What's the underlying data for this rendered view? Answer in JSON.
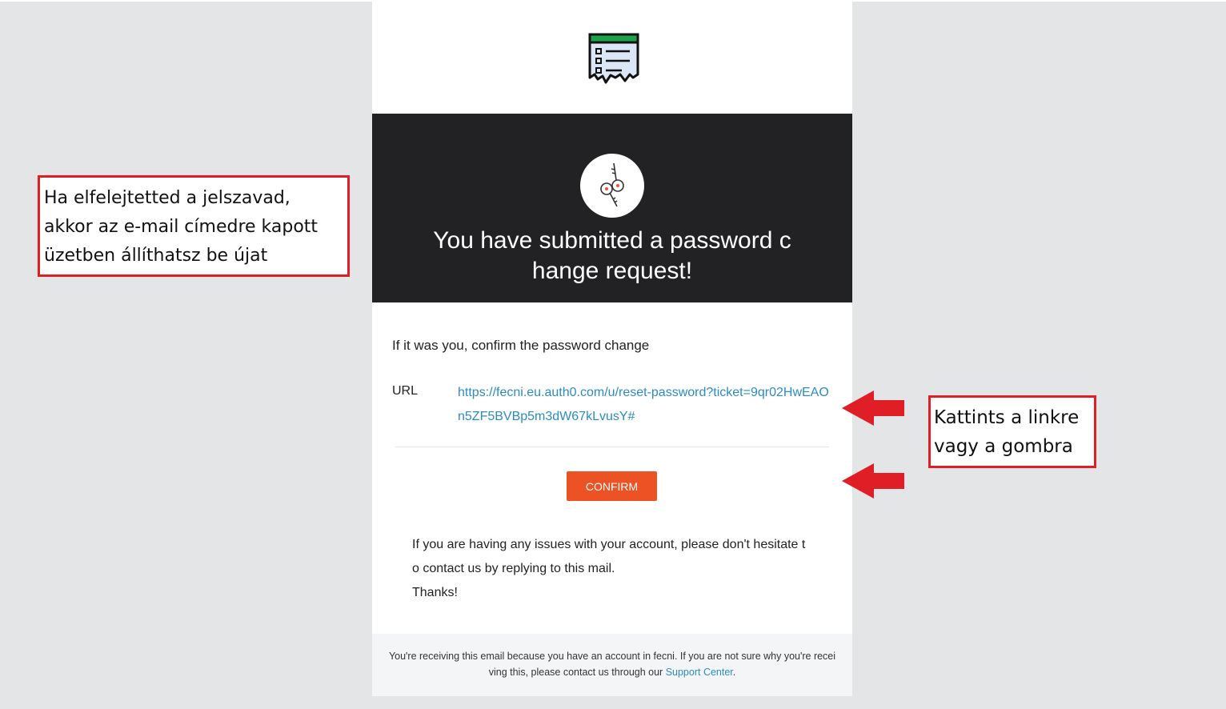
{
  "email": {
    "hero_title": "You have submitted a password change request!",
    "intro": "If it was you, confirm the password change",
    "url_label": "URL",
    "url": "https://fecni.eu.auth0.com/u/reset-password?ticket=9qr02HwEAOn5ZF5BVBp5m3dW67kLvusY#",
    "confirm_label": "CONFIRM",
    "issues_text": "If you are having any issues with your account, please don't hesitate to contact us by replying to this mail.",
    "thanks": "Thanks!",
    "footer_text": "You're receiving this email because you have an account in fecni. If you are not sure why you're receiving this, please contact us through our ",
    "footer_link": "Support Center",
    "footer_end": "."
  },
  "annotations": {
    "left_note": "Ha elfelejtetted a jelszavad, akkor az e-mail címedre kapott üzetben állíthatsz be újat",
    "right_note": "Kattints a linkre vagy a gombra"
  },
  "colors": {
    "hero_bg": "#222225",
    "button_bg": "#ec5224",
    "link": "#2c8bc4",
    "annotation_red": "#e01e25",
    "logo_green": "#1aa34a"
  },
  "icons": {
    "logo": "receipt-list-icon",
    "hero": "keys-icon",
    "arrows": "left-arrow-icon"
  }
}
